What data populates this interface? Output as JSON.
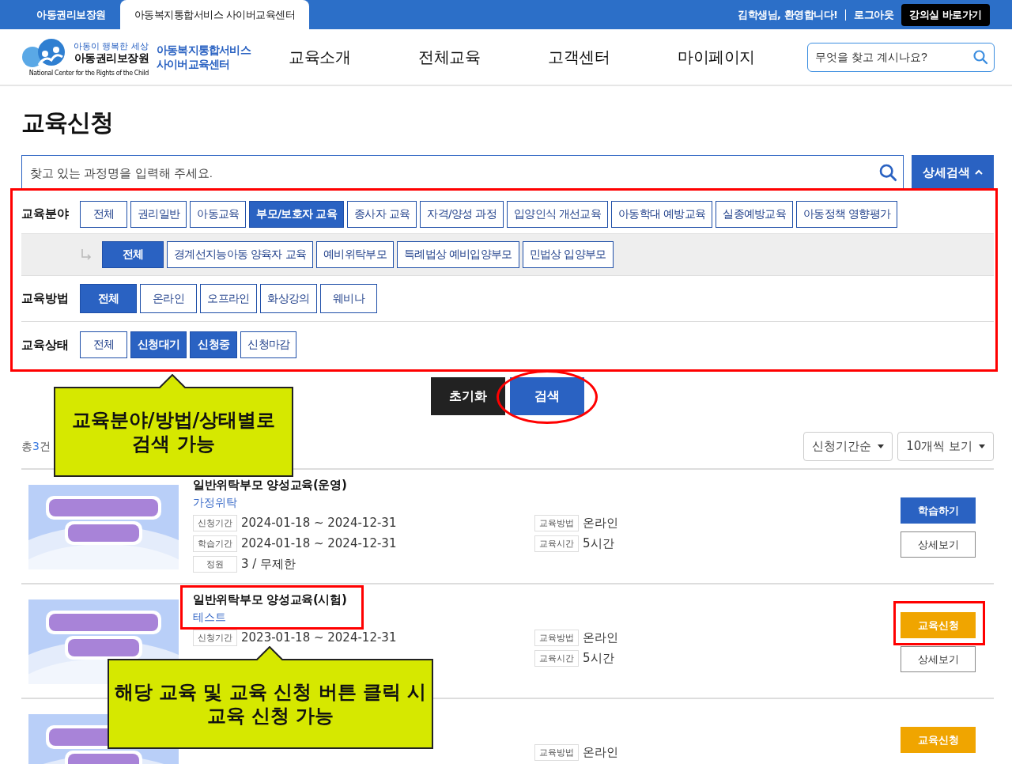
{
  "top_bar": {
    "tabs": [
      {
        "label": "아동권리보장원",
        "selected": false
      },
      {
        "label": "아동복지통합서비스 사이버교육센터",
        "selected": true
      }
    ],
    "greeting": "김학생님, 환영합니다!",
    "logout": "로그아웃",
    "classroom_button": "강의실 바로가기"
  },
  "header": {
    "logo": {
      "slogan": "아동이 행복한 세상",
      "org": "아동권리보장원",
      "english": "National Center for the Rights of the Child",
      "service": [
        "아동복지통합서비스",
        "사이버교육센터"
      ]
    },
    "nav": [
      "교육소개",
      "전체교육",
      "고객센터",
      "마이페이지"
    ],
    "search": {
      "placeholder": "무엇을 찾고 계시나요?"
    }
  },
  "page_title": "교육신청",
  "course_search": {
    "placeholder": "찾고 있는 과정명을 입력해 주세요.",
    "detail_button": "상세검색",
    "expanded": true
  },
  "filters": [
    {
      "label": "교육분야",
      "options": [
        {
          "label": "전체",
          "selected": false
        },
        {
          "label": "권리일반",
          "selected": false
        },
        {
          "label": "아동교육",
          "selected": false
        },
        {
          "label": "부모/보호자 교육",
          "selected": true
        },
        {
          "label": "종사자 교육",
          "selected": false
        },
        {
          "label": "자격/양성 과정",
          "selected": false
        },
        {
          "label": "입양인식 개선교육",
          "selected": false
        },
        {
          "label": "아동학대 예방교육",
          "selected": false
        },
        {
          "label": "실종예방교육",
          "selected": false
        },
        {
          "label": "아동정책 영향평가",
          "selected": false
        }
      ],
      "sub_options": [
        {
          "label": "전체",
          "selected": true
        },
        {
          "label": "경계선지능아동 양육자 교육",
          "selected": false
        },
        {
          "label": "예비위탁부모",
          "selected": false
        },
        {
          "label": "특례법상 예비입양부모",
          "selected": false
        },
        {
          "label": "민법상 입양부모",
          "selected": false
        }
      ]
    },
    {
      "label": "교육방법",
      "options": [
        {
          "label": "전체",
          "selected": true
        },
        {
          "label": "온라인",
          "selected": false
        },
        {
          "label": "오프라인",
          "selected": false
        },
        {
          "label": "화상강의",
          "selected": false
        },
        {
          "label": "웨비나",
          "selected": false
        }
      ]
    },
    {
      "label": "교육상태",
      "options": [
        {
          "label": "전체",
          "selected": false
        },
        {
          "label": "신청대기",
          "selected": true
        },
        {
          "label": "신청중",
          "selected": true
        },
        {
          "label": "신청마감",
          "selected": false
        }
      ]
    }
  ],
  "actions": {
    "reset": "초기화",
    "search": "검색"
  },
  "total": {
    "prefix": "총",
    "count": "3",
    "suffix": "건"
  },
  "sort": [
    "신청기간순",
    "10개씩 보기"
  ],
  "courses": [
    {
      "kind": "picture",
      "title": "일반위탁부모 양성교육(운영)",
      "category": "가정위탁",
      "meta_left": [
        {
          "label": "신청기간",
          "value": "2024-01-18 ~ 2024-12-31"
        },
        {
          "label": "학습기간",
          "value": "2024-01-18 ~ 2024-12-31"
        },
        {
          "label": "정원",
          "value": "3 / 무제한"
        }
      ],
      "meta_right": [
        {
          "label": "교육방법",
          "value": "온라인"
        },
        {
          "label": "교육시간",
          "value": "5시간"
        }
      ],
      "buttons": [
        {
          "kind": "learn",
          "label": "학습하기"
        },
        {
          "kind": "detail",
          "label": "상세보기"
        }
      ]
    },
    {
      "kind": "picture",
      "title": "일반위탁부모 양성교육(시험)",
      "category": "테스트",
      "meta_left": [
        {
          "label": "신청기간",
          "value": "2023-01-18 ~ 2024-12-31"
        }
      ],
      "meta_right": [
        {
          "label": "교육방법",
          "value": "온라인"
        },
        {
          "label": "교육시간",
          "value": "5시간"
        }
      ],
      "buttons": [
        {
          "kind": "apply",
          "label": "교육신청"
        },
        {
          "kind": "detail",
          "label": "상세보기"
        }
      ]
    },
    {
      "kind": "picture",
      "meta_right": [
        {
          "label": "교육방법",
          "value": "온라인"
        }
      ],
      "buttons": [
        {
          "kind": "apply",
          "label": "교육신청"
        }
      ]
    }
  ],
  "annotations": {
    "callouts": [
      {
        "text": "교육분야/방법/상태별로\n검색 가능"
      },
      {
        "text": "해당 교육 및 교육 신청 버튼 클릭 시\n교육 신청 가능"
      }
    ]
  }
}
